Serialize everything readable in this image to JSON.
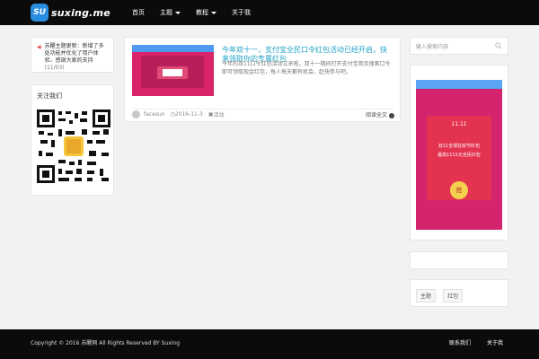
{
  "header": {
    "logo_badge": "SU",
    "logo_text": "suxing.me",
    "nav": [
      {
        "label": "首页"
      },
      {
        "label": "主题"
      },
      {
        "label": "教程"
      },
      {
        "label": "关于我"
      }
    ]
  },
  "left": {
    "notice": "苏醒主题更新：新增了多处功能并优化了用户体验，感谢大家的支持",
    "notice_date": "(11/03)",
    "qr_title": "关注我们"
  },
  "post": {
    "title": "今年双十一，支付宝全民口令红包活动已经开启，快来领取你的专属红包",
    "excerpt": "今年的双11口令红包活动又来啦，双十一期间打开支付宝首页搜索口令即可领取现金红包，每人每天都有机会，赶快参与吧。",
    "author": "facesun",
    "date": "2016-11-3",
    "category": "活动",
    "read_more": "阅读全文"
  },
  "right": {
    "search_placeholder": "输入搜索内容",
    "ad_badge": "11.11",
    "ad_line1": "双11全球狂欢节红包",
    "ad_line2": "最高1111元全民红包",
    "ad_button": "抢",
    "tags": [
      "主题",
      "红包"
    ]
  },
  "footer": {
    "copyright": "Copyright © 2016 苏醒网 All Rights Reserved BY Suxing",
    "links": [
      "联系我们",
      "关于我"
    ]
  }
}
